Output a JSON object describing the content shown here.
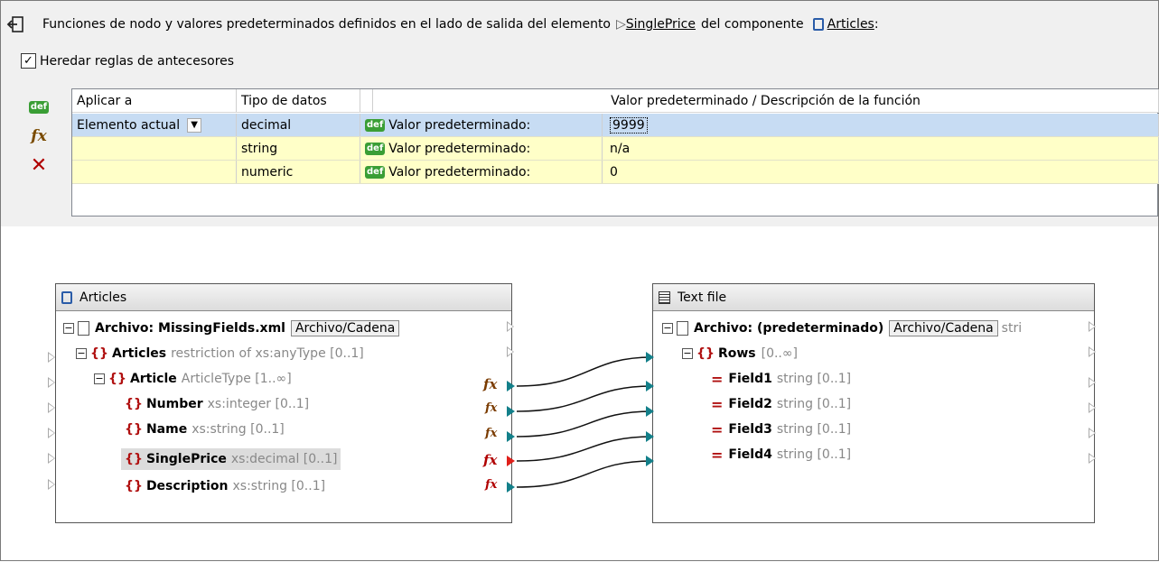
{
  "header": {
    "text_prefix": "Funciones de nodo y valores predeterminados definidos en el lado de salida del elemento",
    "element_link": "SinglePrice",
    "text_mid": "del componente",
    "component_link": "Articles",
    "component_suffix": ":",
    "element_prefix": "▷"
  },
  "inherit": {
    "label": "Heredar reglas de antecesores",
    "checked": true
  },
  "tools": {
    "add_default": "def",
    "add_function": "fx",
    "delete": "✕"
  },
  "grid": {
    "columns": [
      "Aplicar a",
      "Tipo de datos",
      "",
      "Valor predeterminado / Descripción de la función"
    ],
    "rows": [
      {
        "apply_to": "Elemento actual",
        "dtype": "decimal",
        "kind": "Valor predeterminado:",
        "value": "9999",
        "selected": true
      },
      {
        "apply_to": "",
        "dtype": "string",
        "kind": "Valor predeterminado:",
        "value": "n/a"
      },
      {
        "apply_to": "",
        "dtype": "numeric",
        "kind": "Valor predeterminado:",
        "value": "0"
      }
    ],
    "def_badge": "def",
    "dropdown_glyph": "▼"
  },
  "left_component": {
    "title": "Articles",
    "file_label": "Archivo: MissingFields.xml",
    "file_chip": "Archivo/Cadena",
    "items": [
      {
        "name": "Articles",
        "type": "restriction of xs:anyType [0..1]"
      },
      {
        "name": "Article",
        "type": "ArticleType [1..∞]"
      },
      {
        "name": "Number",
        "type": "xs:integer [0..1]"
      },
      {
        "name": "Name",
        "type": "xs:string [0..1]"
      },
      {
        "name": "SinglePrice",
        "type": "xs:decimal [0..1]"
      },
      {
        "name": "Description",
        "type": "xs:string [0..1]"
      }
    ]
  },
  "right_component": {
    "title": "Text file",
    "file_label": "Archivo: (predeterminado)",
    "file_chip": "Archivo/Cadena",
    "file_suffix": "stri",
    "items": [
      {
        "name": "Rows",
        "type": "[0..∞]"
      },
      {
        "name": "Field1",
        "type": "string [0..1]"
      },
      {
        "name": "Field2",
        "type": "string [0..1]"
      },
      {
        "name": "Field3",
        "type": "string [0..1]"
      },
      {
        "name": "Field4",
        "type": "string [0..1]"
      }
    ]
  },
  "glyphs": {
    "minus": "−",
    "brace": "{}",
    "eq": "=",
    "fx": "fx",
    "check": "✓"
  },
  "colors": {
    "selected_row": "#c7dcf3",
    "default_row": "#ffffc8",
    "connector": "#13808a",
    "brace": "#b01010"
  }
}
